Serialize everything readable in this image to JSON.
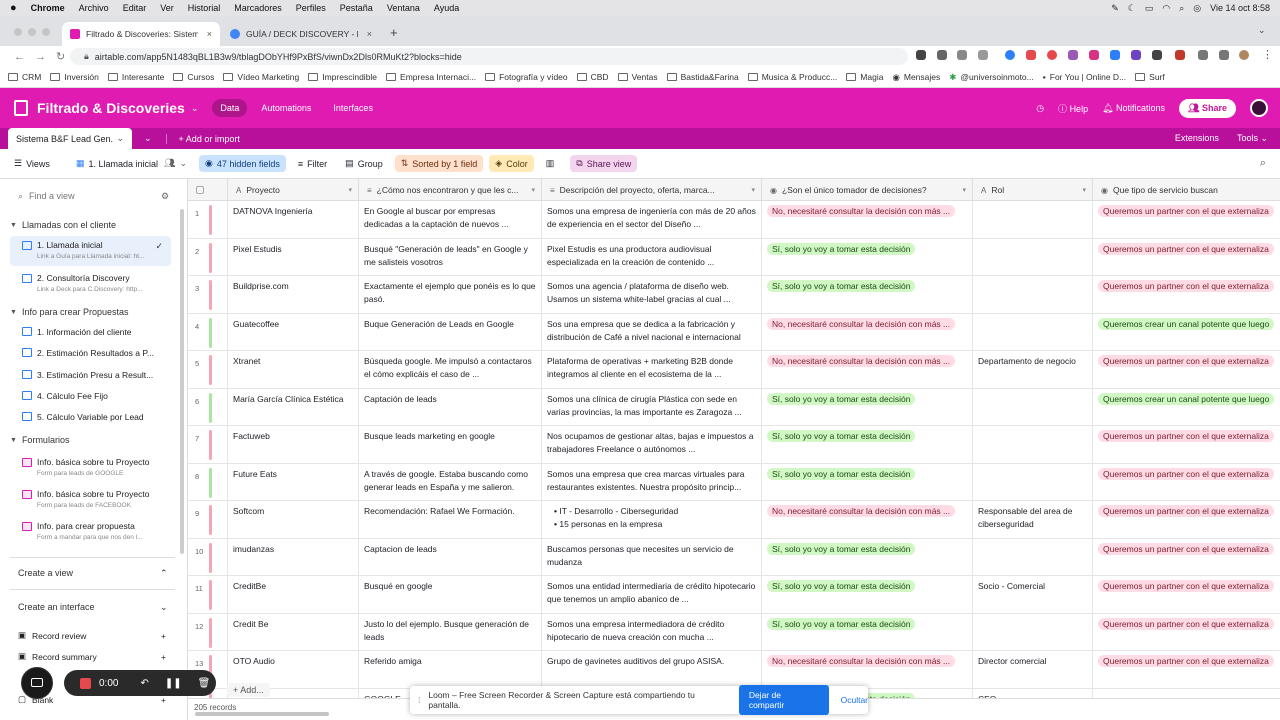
{
  "mac": {
    "app": "Chrome",
    "menus": [
      "Archivo",
      "Editar",
      "Ver",
      "Historial",
      "Marcadores",
      "Perfiles",
      "Pestaña",
      "Ventana",
      "Ayuda"
    ],
    "clock": "Vie 14 oct  8:58"
  },
  "tabs": [
    {
      "title": "Filtrado & Discoveries: Sistema...",
      "close": "×"
    },
    {
      "title": "GUÍA / DECK DISCOVERY - Pre...",
      "close": "×"
    }
  ],
  "new_tab": "+",
  "url": "airtable.com/app5N1483qBL1B3w9/tblagDObYHf9PxBfS/viwnDx2Dls0RMuKt2?blocks=hide",
  "bookmarks": [
    "CRM",
    "Inversión",
    "Interesante",
    "Cursos",
    "Vídeo Marketing",
    "Imprescindible",
    "Empresa Internaci...",
    "Fotografía y vídeo",
    "CBD",
    "Ventas",
    "Bastida&Farina",
    "Musica & Producc...",
    "Magia",
    "Mensajes",
    "@universoinmoto...",
    "For You | Online D...",
    "Surf"
  ],
  "header": {
    "base_name": "Filtrado & Discoveries",
    "nav": [
      "Data",
      "Automations",
      "Interfaces"
    ],
    "help": "Help",
    "notifications": "Notifications",
    "share": "Share"
  },
  "tablebar": {
    "table": "Sistema B&F Lead Gen.",
    "add_import": "+ Add or import",
    "extensions": "Extensions",
    "tools": "Tools"
  },
  "viewbar": {
    "views": "Views",
    "view_name": "1. Llamada inicial",
    "hidden": "47 hidden fields",
    "filter": "Filter",
    "group": "Group",
    "sorted": "Sorted by 1 field",
    "color": "Color",
    "share_view": "Share view"
  },
  "sidebar": {
    "find": "Find a view",
    "sec1": "Llamadas con el cliente",
    "item1": {
      "t": "1. Llamada inicial",
      "s": "Link a Guía para Llamada inicial: ht..."
    },
    "item2": {
      "t": "2. Consultoría Discovery",
      "s": "Link a Deck para C.Discovery: http..."
    },
    "sec2": "Info para crear Propuestas",
    "grid_items": [
      "1. Información del cliente",
      "2. Estimación Resultados a P...",
      "3. Estimación Presu a Result...",
      "4. Cálculo Fee Fijo",
      "5. Cálculo Variable por Lead"
    ],
    "sec3": "Formularios",
    "forms": [
      {
        "t": "Info. básica sobre tu Proyecto",
        "s": "Form para leads de GOOGLE"
      },
      {
        "t": "Info. básica sobre tu Proyecto",
        "s": "Form para leads de FACEBOOK"
      },
      {
        "t": "Info. para crear propuesta",
        "s": "Form a mandar para que nos den l..."
      }
    ],
    "create_view": "Create a view",
    "create_interface": "Create an interface",
    "record_review": "Record review",
    "record_summary": "Record summary",
    "blank": "Blank"
  },
  "columns": [
    "Proyecto",
    "¿Cómo nos encontraron y que les c...",
    "Descripción del proyecto, oferta, marca...",
    "¿Son el único tomador de decisiones?",
    "Rol",
    "Que tipo de servicio buscan"
  ],
  "rows": [
    {
      "n": "1",
      "bar": "#f4a6b6",
      "p": "DATNOVA Ingeniería",
      "c": "En Google al buscar por empresas dedicadas a la captación de nuevos ...",
      "d": "Somos una empresa de ingeniería con más de 20 años de experiencia en el sector del Diseño ...",
      "dec": "No, necesitaré consultar la decisión con más ...",
      "dc": "red",
      "rol": "",
      "srv": "Queremos un partner con el que externaliza",
      "sc": "red"
    },
    {
      "n": "2",
      "bar": "#f4a6b6",
      "p": "Pixel Estudis",
      "c": "Busqué \"Generación de leads\" en Google y me salisteis vosotros",
      "d": "Pixel Estudis es una productora audiovisual especializada en la creación de contenido ...",
      "dec": "Sí, solo yo voy a tomar esta decisión",
      "dc": "green",
      "rol": "",
      "srv": "Queremos un partner con el que externaliza",
      "sc": "red"
    },
    {
      "n": "3",
      "bar": "#f4a6b6",
      "p": "Buildprise.com",
      "c": "Exactamente el ejemplo que ponéis es lo que pasó.",
      "d": "Somos una agencia / plataforma de diseño web. Usamos un sistema white-label gracias al cual ...",
      "dec": "Sí, solo yo voy a tomar esta decisión",
      "dc": "green",
      "rol": "",
      "srv": "Queremos un partner con el que externaliza",
      "sc": "red"
    },
    {
      "n": "4",
      "bar": "#a8e6a0",
      "p": "Guatecoffee",
      "c": "Buque Generación de Leads en Google",
      "d": "Sos una empresa que se dedica a la fabricación y distribución de Café a nivel nacional e internacional",
      "dec": "No, necesitaré consultar la decisión con más ...",
      "dc": "red",
      "rol": "",
      "srv": "Queremos crear un canal potente que luego",
      "sc": "green"
    },
    {
      "n": "5",
      "bar": "#f4a6b6",
      "p": "Xtranet",
      "c": "Búsqueda google. Me impulsó a contactaros el cómo explicáis el caso de ...",
      "d": "Plataforma de operativas + marketing B2B  donde integramos al cliente en el ecosistema de la ...",
      "dec": "No, necesitaré consultar la decisión con más ...",
      "dc": "red",
      "rol": "Departamento de negocio",
      "srv": "Queremos un partner con el que externaliza",
      "sc": "red"
    },
    {
      "n": "6",
      "bar": "#a8e6a0",
      "p": "María García Clínica Estética",
      "c": "Captación de leads",
      "d": "Somos una clínica de cirugía Plástica con sede en varias provincias, la mas importante es Zaragoza ...",
      "dec": "Sí, solo yo voy a tomar esta decisión",
      "dc": "green",
      "rol": "",
      "srv": "Queremos crear un canal potente que luego",
      "sc": "green"
    },
    {
      "n": "7",
      "bar": "#f4a6b6",
      "p": "Factuweb",
      "c": "Busque leads marketing en google",
      "d": "Nos ocupamos de gestionar altas, bajas e impuestos a trabajadores Freelance o autónomos ...",
      "dec": "Sí, solo yo voy a tomar esta decisión",
      "dc": "green",
      "rol": "",
      "srv": "Queremos un partner con el que externaliza",
      "sc": "red"
    },
    {
      "n": "8",
      "bar": "#a8e6a0",
      "p": "Future Eats",
      "c": "A través de google. Estaba buscando como generar leads en España y me salieron.",
      "d": "Somos una empresa que crea marcas virtuales para restaurantes existentes. Nuestra propósito princip...",
      "dec": "Sí, solo yo voy a tomar esta decisión",
      "dc": "green",
      "rol": "",
      "srv": "Queremos un partner con el que externaliza",
      "sc": "red"
    },
    {
      "n": "9",
      "bar": "#f4a6b6",
      "p": "Softcom",
      "c": "Recomendación: Rafael We Formación.",
      "d": "",
      "bullets": [
        "IT - Desarrollo - Ciberseguridad",
        "15 personas en la empresa"
      ],
      "dec": "No, necesitaré consultar la decisión con más ...",
      "dc": "red",
      "rol": "Responsable del area de ciberseguridad",
      "srv": "Queremos un partner con el que externaliza",
      "sc": "red"
    },
    {
      "n": "10",
      "bar": "#f4a6b6",
      "p": "imudanzas",
      "c": "Captacion de leads",
      "d": "Buscamos personas que necesites un servicio de mudanza",
      "dec": "Sí, solo yo voy a tomar esta decisión",
      "dc": "green",
      "rol": "",
      "srv": "Queremos un partner con el que externaliza",
      "sc": "red"
    },
    {
      "n": "11",
      "bar": "#f4a6b6",
      "p": "CreditBe",
      "c": "Busqué en google",
      "d": "Somos una entidad intermediaria de crédito hipotecario que tenemos un amplio abanico de ...",
      "dec": "Sí, solo yo voy a tomar esta decisión",
      "dc": "green",
      "rol": "Socio - Comercial",
      "srv": "Queremos un partner con el que externaliza",
      "sc": "red"
    },
    {
      "n": "12",
      "bar": "#f4a6b6",
      "p": "Credit Be",
      "c": "Justo lo del ejemplo. Busque generación de leads",
      "d": "Somos una empresa intermediadora de crédito hipotecario de nueva creación con mucha ...",
      "dec": "Sí, solo yo voy a tomar esta decisión",
      "dc": "green",
      "rol": "",
      "srv": "Queremos un partner con el que externaliza",
      "sc": "red"
    },
    {
      "n": "13",
      "bar": "#f4a6b6",
      "p": "OTO Audio",
      "c": "Referido amiga",
      "d": "Grupo de gavinetes auditivos del grupo ASISA.",
      "dec": "No, necesitaré consultar la decisión con más ...",
      "dc": "red",
      "rol": "Director comercial",
      "srv": "Queremos un partner con el que externaliza",
      "sc": "red"
    },
    {
      "n": "14",
      "bar": "#f4a6b6",
      "p": "",
      "c": "GOOGLE",
      "d": "",
      "dec": "Sí, solo yo voy a tomar esta decisión",
      "dc": "green",
      "rol": "CEO",
      "srv": "",
      "sc": "red"
    }
  ],
  "footer": {
    "records": "205 records",
    "add": "Add..."
  },
  "loom": {
    "time": "0:00",
    "share_msg": "Loom – Free Screen Recorder & Screen Capture está compartiendo tu pantalla.",
    "stop": "Dejar de compartir",
    "hide": "Ocultar"
  },
  "colors": {
    "brand": "#e01bb1",
    "tablebar": "#b8109a",
    "accent": "#2d7ff9"
  }
}
